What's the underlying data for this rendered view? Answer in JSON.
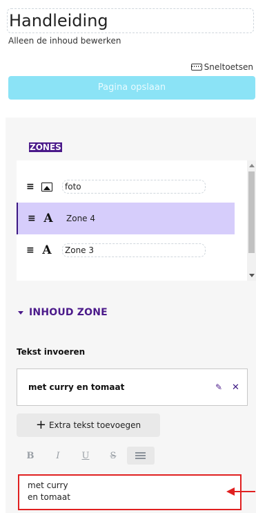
{
  "page": {
    "title": "Handleiding",
    "subtitle": "Alleen de inhoud bewerken",
    "shortcuts_label": "Sneltoetsen",
    "save_button": "Pagina opslaan"
  },
  "zones": {
    "heading": "ZONES",
    "items": [
      {
        "name": "foto",
        "type_icon": "image-icon"
      },
      {
        "name": "Zone 4",
        "type_icon": "text-icon",
        "selected": true
      },
      {
        "name": "Zone 3",
        "type_icon": "text-icon"
      }
    ]
  },
  "content": {
    "section_title": "INHOUD ZONE",
    "field_label": "Tekst invoeren",
    "text_item": "met curry en tomaat",
    "add_button": "Extra tekst toevoegen",
    "toolbar": {
      "bold": "B",
      "italic": "I",
      "underline": "U",
      "strike": "S"
    },
    "editor_lines": [
      "met curry",
      "en tomaat"
    ]
  },
  "colors": {
    "accent": "#4b1a8a",
    "save_button_bg": "#8be3f6",
    "selected_zone_bg": "#d6cdfb",
    "highlight": "#e02020"
  }
}
